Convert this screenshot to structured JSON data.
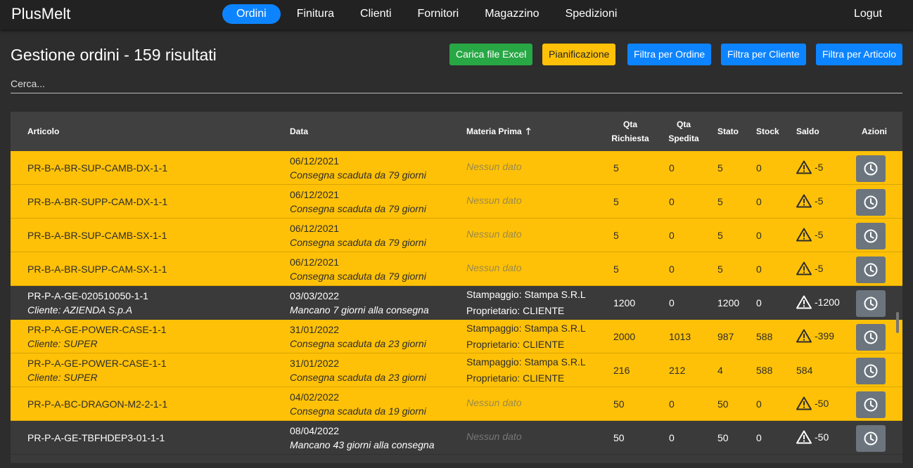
{
  "app": {
    "brand": "PlusMelt",
    "logout": "Logut"
  },
  "nav": [
    {
      "label": "Ordini",
      "active": true
    },
    {
      "label": "Finitura"
    },
    {
      "label": "Clienti"
    },
    {
      "label": "Fornitori"
    },
    {
      "label": "Magazzino"
    },
    {
      "label": "Spedizioni"
    }
  ],
  "page": {
    "title": "Gestione ordini - 159 risultati"
  },
  "toolbar": {
    "upload_excel": "Carica file Excel",
    "planning": "Pianificazione",
    "filter_order": "Filtra per Ordine",
    "filter_client": "Filtra per Cliente",
    "filter_article": "Filtra per Articolo"
  },
  "search": {
    "placeholder": "Cerca..."
  },
  "table": {
    "headers": {
      "articolo": "Articolo",
      "data": "Data",
      "materia_prima": "Materia Prima",
      "qta_richiesta": "Qta Richiesta",
      "qta_spedita": "Qta Spedita",
      "stato": "Stato",
      "stock": "Stock",
      "saldo": "Saldo",
      "azioni": "Azioni"
    },
    "rows": [
      {
        "articolo": "PR-B-A-BR-SUP-CAMB-DX-1-1",
        "cliente": "",
        "data": "06/12/2021",
        "nota": "Consegna scaduta da 79 giorni",
        "mp1": "Nessun dato",
        "mp2": "",
        "qta_richiesta": "5",
        "qta_spedita": "0",
        "stato": "5",
        "stock": "0",
        "saldo": "-5",
        "warning": true,
        "color": "yellow"
      },
      {
        "articolo": "PR-B-A-BR-SUPP-CAM-DX-1-1",
        "cliente": "",
        "data": "06/12/2021",
        "nota": "Consegna scaduta da 79 giorni",
        "mp1": "Nessun dato",
        "mp2": "",
        "qta_richiesta": "5",
        "qta_spedita": "0",
        "stato": "5",
        "stock": "0",
        "saldo": "-5",
        "warning": true,
        "color": "yellow"
      },
      {
        "articolo": "PR-B-A-BR-SUP-CAMB-SX-1-1",
        "cliente": "",
        "data": "06/12/2021",
        "nota": "Consegna scaduta da 79 giorni",
        "mp1": "Nessun dato",
        "mp2": "",
        "qta_richiesta": "5",
        "qta_spedita": "0",
        "stato": "5",
        "stock": "0",
        "saldo": "-5",
        "warning": true,
        "color": "yellow"
      },
      {
        "articolo": "PR-B-A-BR-SUPP-CAM-SX-1-1",
        "cliente": "",
        "data": "06/12/2021",
        "nota": "Consegna scaduta da 79 giorni",
        "mp1": "Nessun dato",
        "mp2": "",
        "qta_richiesta": "5",
        "qta_spedita": "0",
        "stato": "5",
        "stock": "0",
        "saldo": "-5",
        "warning": true,
        "color": "yellow"
      },
      {
        "articolo": "PR-P-A-GE-020510050-1-1",
        "cliente": "Cliente: AZIENDA S.p.A",
        "data": "03/03/2022",
        "nota": "Mancano 7 giorni alla consegna",
        "mp1": "Stampaggio: Stampa S.R.L",
        "mp2": "Proprietario: CLIENTE",
        "qta_richiesta": "1200",
        "qta_spedita": "0",
        "stato": "1200",
        "stock": "0",
        "saldo": "-1200",
        "warning": true,
        "color": "dark"
      },
      {
        "articolo": "PR-P-A-GE-POWER-CASE-1-1",
        "cliente": "Cliente: SUPER",
        "data": "31/01/2022",
        "nota": "Consegna scaduta da 23 giorni",
        "mp1": "Stampaggio: Stampa S.R.L",
        "mp2": "Proprietario: CLIENTE",
        "qta_richiesta": "2000",
        "qta_spedita": "1013",
        "stato": "987",
        "stock": "588",
        "saldo": "-399",
        "warning": true,
        "color": "yellow"
      },
      {
        "articolo": "PR-P-A-GE-POWER-CASE-1-1",
        "cliente": "Cliente: SUPER",
        "data": "31/01/2022",
        "nota": "Consegna scaduta da 23 giorni",
        "mp1": "Stampaggio: Stampa S.R.L",
        "mp2": "Proprietario: CLIENTE",
        "qta_richiesta": "216",
        "qta_spedita": "212",
        "stato": "4",
        "stock": "588",
        "saldo": "584",
        "warning": false,
        "color": "yellow"
      },
      {
        "articolo": "PR-P-A-BC-DRAGON-M2-2-1-1",
        "cliente": "",
        "data": "04/02/2022",
        "nota": "Consegna scaduta da 19 giorni",
        "mp1": "Nessun dato",
        "mp2": "",
        "qta_richiesta": "50",
        "qta_spedita": "0",
        "stato": "50",
        "stock": "0",
        "saldo": "-50",
        "warning": true,
        "color": "yellow"
      },
      {
        "articolo": "PR-P-A-GE-TBFHDEP3-01-1-1",
        "cliente": "",
        "data": "08/04/2022",
        "nota": "Mancano 43 giorni alla consegna",
        "mp1": "Nessun dato",
        "mp2": "",
        "qta_richiesta": "50",
        "qta_spedita": "0",
        "stato": "50",
        "stock": "0",
        "saldo": "-50",
        "warning": true,
        "color": "dark"
      }
    ]
  }
}
